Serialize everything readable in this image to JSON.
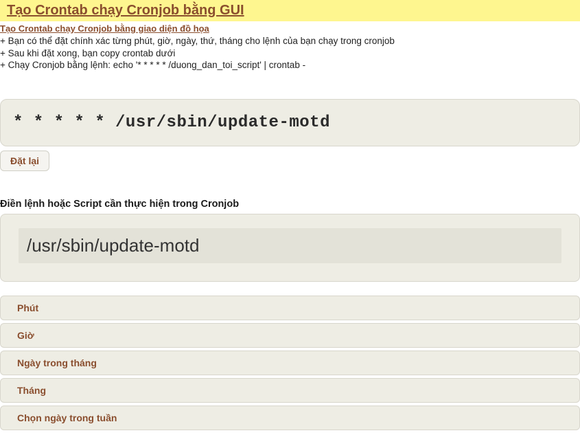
{
  "header": {
    "title": "Tạo Crontab chạy Cronjob bằng GUI"
  },
  "subheader": {
    "link": "Tạo Crontab chạy Cronjob bằng giao diện đồ họa"
  },
  "info": {
    "line1": "+ Bạn có thể đặt chính xác từng phút, giờ, ngày, thứ, tháng cho lệnh của bạn chạy trong cronjob",
    "line2": "+ Sau khi đặt xong, bạn copy crontab dưới",
    "line3": "+ Chạy Cronjob bằng lệnh: echo '* * * * * /duong_dan_toi_script' | crontab -"
  },
  "crontab": {
    "expression": "*  *  *  *  *  /usr/sbin/update-motd"
  },
  "buttons": {
    "reset": "Đặt lại"
  },
  "script": {
    "label": "Điền lệnh hoặc Script cần thực hiện trong Cronjob",
    "value": "/usr/sbin/update-motd"
  },
  "accordion": {
    "items": [
      {
        "label": "Phút"
      },
      {
        "label": "Giờ"
      },
      {
        "label": "Ngày trong tháng"
      },
      {
        "label": "Tháng"
      },
      {
        "label": "Chọn ngày trong tuần"
      }
    ]
  }
}
